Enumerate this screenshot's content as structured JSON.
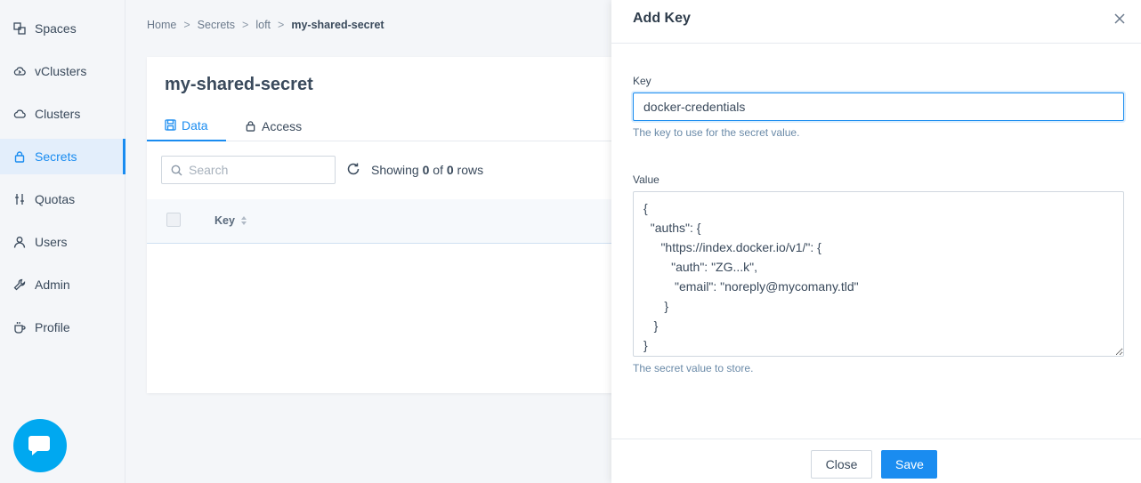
{
  "sidebar": {
    "items": [
      {
        "label": "Spaces",
        "icon": "spaces-icon"
      },
      {
        "label": "vClusters",
        "icon": "vclusters-icon"
      },
      {
        "label": "Clusters",
        "icon": "cloud-icon"
      },
      {
        "label": "Secrets",
        "icon": "lock-icon",
        "active": true
      },
      {
        "label": "Quotas",
        "icon": "sliders-icon"
      },
      {
        "label": "Users",
        "icon": "user-icon"
      },
      {
        "label": "Admin",
        "icon": "wrench-icon"
      },
      {
        "label": "Profile",
        "icon": "coffee-icon"
      }
    ],
    "chat_icon": "chat-icon"
  },
  "breadcrumb": {
    "items": [
      "Home",
      "Secrets",
      "loft"
    ],
    "current": "my-shared-secret",
    "separator": ">"
  },
  "card": {
    "title": "my-shared-secret",
    "tabs": [
      {
        "label": "Data",
        "icon": "save-icon",
        "active": true
      },
      {
        "label": "Access",
        "icon": "lock-icon"
      }
    ],
    "search": {
      "placeholder": "Search"
    },
    "rows_info": {
      "prefix": "Showing",
      "shown": "0",
      "of": "of",
      "total": "0",
      "suffix": "rows"
    },
    "table": {
      "columns": [
        "Key"
      ]
    }
  },
  "drawer": {
    "title": "Add Key",
    "key_label": "Key",
    "key_value": "docker-credentials",
    "key_hint": "The key to use for the secret value.",
    "value_label": "Value",
    "value_text": "{\n  \"auths\": {\n     \"https://index.docker.io/v1/\": {\n        \"auth\": \"ZG...k\",\n         \"email\": \"noreply@mycomany.tld\"\n      }\n   }\n}",
    "value_hint": "The secret value to store.",
    "close_label": "Close",
    "save_label": "Save"
  },
  "colors": {
    "accent": "#1a8cf0",
    "chat": "#00a8f0",
    "background": "#f4f6f9"
  }
}
